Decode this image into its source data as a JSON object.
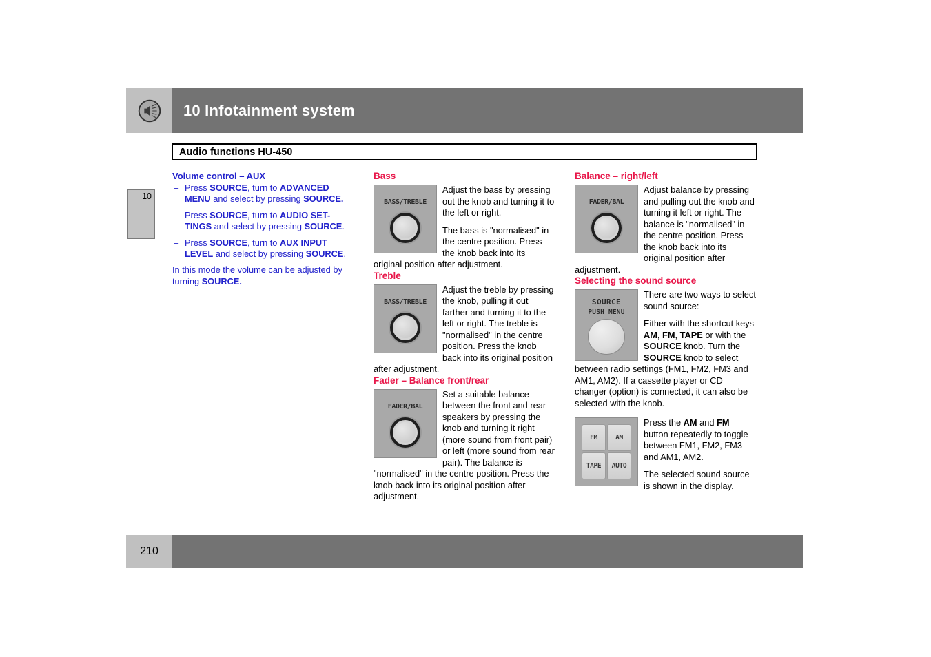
{
  "header": {
    "icon": "speaker-volume-icon",
    "chapter_title": "10 Infotainment system",
    "block_color": "#c0c0c0",
    "bar_color": "#737373"
  },
  "section": {
    "title": "Audio functions HU-450"
  },
  "chapter_tab": {
    "number": "10"
  },
  "colors": {
    "heading_blue": "#2222cc",
    "heading_red": "#e8174a",
    "body_text": "#000000",
    "panel_grey": "#a9a9a9"
  },
  "columns": {
    "left": {
      "heading": "Volume control – AUX",
      "bullets": [
        {
          "parts": [
            {
              "text": "Press ",
              "bold": false
            },
            {
              "text": "SOURCE",
              "bold": true
            },
            {
              "text": ", turn to ",
              "bold": false
            },
            {
              "text": "ADVANCED MENU",
              "bold": true
            },
            {
              "text": " and select by pressing ",
              "bold": false
            },
            {
              "text": "SOURCE.",
              "bold": true
            }
          ]
        },
        {
          "parts": [
            {
              "text": "Press ",
              "bold": false
            },
            {
              "text": "SOURCE",
              "bold": true
            },
            {
              "text": ", turn to ",
              "bold": false
            },
            {
              "text": "AUDIO SET-TINGS",
              "bold": true
            },
            {
              "text": " and select by pressing ",
              "bold": false
            },
            {
              "text": "SOURCE",
              "bold": true
            },
            {
              "text": ".",
              "bold": false
            }
          ]
        },
        {
          "parts": [
            {
              "text": "Press ",
              "bold": false
            },
            {
              "text": "SOURCE",
              "bold": true
            },
            {
              "text": ", turn to ",
              "bold": false
            },
            {
              "text": "AUX INPUT LEVEL",
              "bold": true
            },
            {
              "text": " and select by pressing ",
              "bold": false
            },
            {
              "text": "SOURCE",
              "bold": true
            },
            {
              "text": ".",
              "bold": false
            }
          ]
        }
      ],
      "closing": {
        "parts": [
          {
            "text": "In this mode the volume can be adjusted by turning ",
            "bold": false
          },
          {
            "text": "SOURCE.",
            "bold": true
          }
        ]
      }
    },
    "middle": {
      "bass": {
        "heading": "Bass",
        "figure": {
          "type": "knob-panel",
          "label": "BASS/TREBLE"
        },
        "paragraphs": [
          "Adjust the bass by pressing out the knob and turning it to the left or right.",
          "The bass is \"normalised\" in the centre position. Press the knob back into its original position after adjustment."
        ]
      },
      "treble": {
        "heading": "Treble",
        "figure": {
          "type": "knob-panel",
          "label": "BASS/TREBLE"
        },
        "paragraphs": [
          "Adjust the treble by pressing the knob, pulling it out farther and turning it to the left or right. The treble is \"normalised\" in the centre position. Press the knob back into its original position after adjustment."
        ]
      },
      "fader": {
        "heading": "Fader – Balance front/rear",
        "figure": {
          "type": "knob-panel",
          "label": "FADER/BAL"
        },
        "paragraphs": [
          "Set a suitable balance between the front and rear speakers by pressing the knob and turning it right (more sound from front pair) or left (more sound from rear pair). The balance is \"normalised\" in the centre position. Press the knob back into its original position after adjustment."
        ]
      }
    },
    "right": {
      "balance": {
        "heading": "Balance – right/left",
        "figure": {
          "type": "knob-panel",
          "label": "FADER/BAL"
        },
        "paragraphs": [
          "Adjust balance by pressing and pulling out the knob and turning it left or right. The balance is \"normalised\" in the centre position. Press the knob back into its original position after adjustment."
        ]
      },
      "sound_source": {
        "heading": "Selecting the sound source",
        "figure": {
          "type": "source-knob-panel",
          "label_top": "SOURCE",
          "label_bottom": "PUSH MENU"
        },
        "paragraph1": "There are two ways to select sound source:",
        "paragraph2_parts": [
          {
            "text": "Either with the shortcut keys ",
            "bold": false
          },
          {
            "text": "AM",
            "bold": true
          },
          {
            "text": ", ",
            "bold": false
          },
          {
            "text": "FM",
            "bold": true
          },
          {
            "text": ", ",
            "bold": false
          },
          {
            "text": "TAPE",
            "bold": true
          },
          {
            "text": " or with the ",
            "bold": false
          },
          {
            "text": "SOURCE",
            "bold": true
          },
          {
            "text": " knob. Turn the ",
            "bold": false
          },
          {
            "text": "SOURCE",
            "bold": true
          },
          {
            "text": " knob to select between radio settings (FM1, FM2, FM3 and AM1, AM2). If a cassette player or CD changer (option) is connected, it can also be selected with the knob.",
            "bold": false
          }
        ],
        "buttons_figure": {
          "type": "button-pad",
          "keys": [
            "FM",
            "AM",
            "TAPE",
            "AUTO"
          ]
        },
        "paragraph3_parts": [
          {
            "text": "Press the ",
            "bold": false
          },
          {
            "text": "AM",
            "bold": true
          },
          {
            "text": " and ",
            "bold": false
          },
          {
            "text": "FM",
            "bold": true
          },
          {
            "text": " button repeatedly to toggle between FM1, FM2, FM3 and AM1, AM2.",
            "bold": false
          }
        ],
        "paragraph4": "The selected sound source is shown in the display."
      }
    }
  },
  "footer": {
    "page_number": "210"
  }
}
